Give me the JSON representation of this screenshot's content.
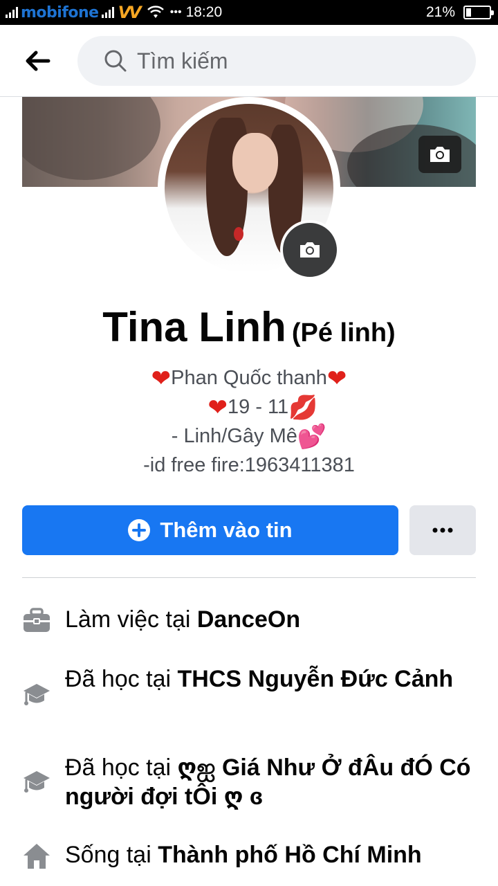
{
  "status_bar": {
    "carrier": "mobifone",
    "carrier2": "VV",
    "dots": "•••",
    "time": "18:20",
    "battery": "21%",
    "battery_level": 0.21
  },
  "search": {
    "placeholder": "Tìm kiếm"
  },
  "profile": {
    "name": "Tina Linh",
    "nickname": "(Pé linh)",
    "bio": {
      "line1": "Phan Quốc thanh",
      "line2": "19 - 11",
      "line3": "- Linh/Gây Mê",
      "line4": "-id free fire:1963411381",
      "heart_emoji": "❤",
      "kiss_emoji": "💋",
      "two_hearts_emoji": "💕"
    }
  },
  "actions": {
    "add_story_label": "Thêm vào tin",
    "more_label": "•••"
  },
  "details": [
    {
      "prefix": "Làm việc tại ",
      "value": "DanceOn",
      "icon": "briefcase-icon"
    },
    {
      "prefix": "Đã học tại ",
      "value": "THCS Nguyễn Đức Cảnh",
      "icon": "graduation-cap-icon"
    },
    {
      "prefix": "Đã học tại ",
      "value": "ღஐ Giá Như Ở đÂu đÓ Có người đợi tÔi ღ ɞ",
      "icon": "graduation-cap-icon"
    },
    {
      "prefix": "Sống tại ",
      "value": "Thành phố Hồ Chí Minh",
      "icon": "home-icon"
    }
  ],
  "colors": {
    "accent": "#1877f2",
    "heart": "#e0201a",
    "carrier": "#1e73d2",
    "carrier2": "#f5a623"
  }
}
